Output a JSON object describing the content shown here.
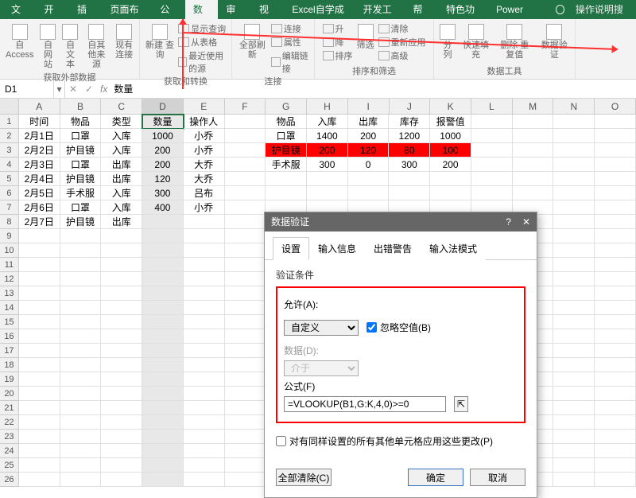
{
  "tabs": [
    "文件",
    "开始",
    "插入",
    "页面布局",
    "公式",
    "数据",
    "审阅",
    "视图",
    "Excel自学成才",
    "开发工具",
    "帮助",
    "特色功能",
    "Power Pivot"
  ],
  "activeTab": 5,
  "searchTip": "操作说明搜索",
  "ribbonGroups": {
    "g1": {
      "items": [
        "自 Access",
        "自网站",
        "自文本",
        "自其他来源",
        "现有连接"
      ],
      "label": "获取外部数据"
    },
    "g2": {
      "main": "新建\n查询",
      "lines": [
        "显示查询",
        "从表格",
        "最近使用的源"
      ],
      "label": "获取和转换"
    },
    "g3": {
      "main": "全部刷新",
      "lines": [
        "连接",
        "属性",
        "编辑链接"
      ],
      "label": "连接"
    },
    "g4": {
      "sort": [
        "升",
        "降",
        "排序"
      ],
      "filter": "筛选",
      "lines": [
        "清除",
        "重新应用",
        "高级"
      ],
      "label": "排序和筛选"
    },
    "g5": {
      "items": [
        "分列",
        "快速填充",
        "删除\n重复值",
        "数据验\n证"
      ],
      "label": "数据工具"
    }
  },
  "nameBox": "D1",
  "formula": "数量",
  "cols": [
    "A",
    "B",
    "C",
    "D",
    "E",
    "F",
    "G",
    "H",
    "I",
    "J",
    "K",
    "L",
    "M",
    "N",
    "O"
  ],
  "leftTable": {
    "headers": [
      "时间",
      "物品",
      "类型",
      "数量",
      "操作人"
    ],
    "rows": [
      [
        "2月1日",
        "口罩",
        "入库",
        "1000",
        "小乔"
      ],
      [
        "2月2日",
        "护目镜",
        "入库",
        "200",
        "小乔"
      ],
      [
        "2月3日",
        "口罩",
        "出库",
        "200",
        "大乔"
      ],
      [
        "2月4日",
        "护目镜",
        "出库",
        "120",
        "大乔"
      ],
      [
        "2月5日",
        "手术服",
        "入库",
        "300",
        "吕布"
      ],
      [
        "2月6日",
        "口罩",
        "入库",
        "400",
        "小乔"
      ],
      [
        "2月7日",
        "护目镜",
        "出库",
        "",
        ""
      ]
    ]
  },
  "rightTable": {
    "headers": [
      "物品",
      "入库",
      "出库",
      "库存",
      "报警值"
    ],
    "rows": [
      [
        "口罩",
        "1400",
        "200",
        "1200",
        "1000"
      ],
      [
        "护目镜",
        "200",
        "120",
        "80",
        "100"
      ],
      [
        "手术服",
        "300",
        "0",
        "300",
        "200"
      ]
    ],
    "alertRow": 1
  },
  "dialog": {
    "title": "数据验证",
    "tabs": [
      "设置",
      "输入信息",
      "出错警告",
      "输入法模式"
    ],
    "activeTab": 0,
    "section": "验证条件",
    "allowLabel": "允许(A):",
    "allowValue": "自定义",
    "ignoreBlank": "忽略空值(B)",
    "dataLabel": "数据(D):",
    "dataValue": "介于",
    "formulaLabel": "公式(F)",
    "formulaValue": "=VLOOKUP(B1,G:K,4,0)>=0",
    "applyAll": "对有同样设置的所有其他单元格应用这些更改(P)",
    "clearAll": "全部清除(C)",
    "ok": "确定",
    "cancel": "取消"
  }
}
